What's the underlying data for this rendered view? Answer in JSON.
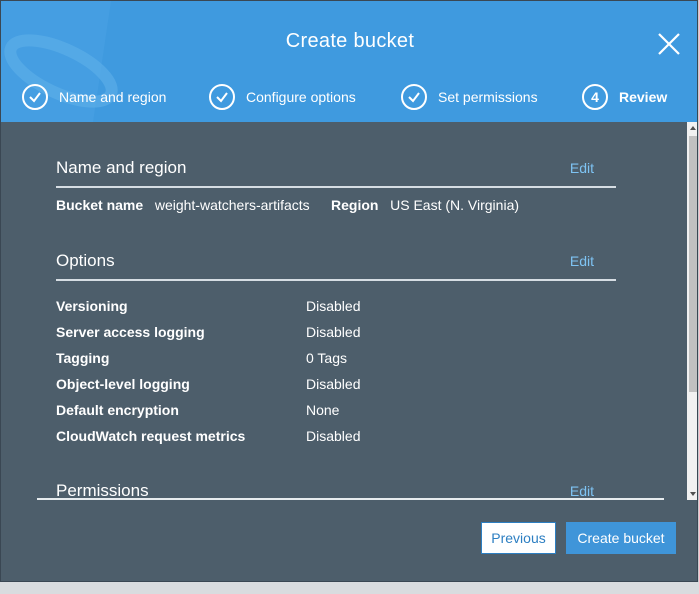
{
  "modal": {
    "title": "Create bucket",
    "steps": [
      {
        "label": "Name and region",
        "state": "done"
      },
      {
        "label": "Configure options",
        "state": "done"
      },
      {
        "label": "Set permissions",
        "state": "done"
      },
      {
        "label": "Review",
        "state": "active",
        "number": "4"
      }
    ]
  },
  "review": {
    "name_region": {
      "title": "Name and region",
      "edit_label": "Edit",
      "bucket_name_label": "Bucket name",
      "bucket_name_value": "weight-watchers-artifacts",
      "region_label": "Region",
      "region_value": "US East (N. Virginia)"
    },
    "options": {
      "title": "Options",
      "edit_label": "Edit",
      "rows": [
        {
          "label": "Versioning",
          "value": "Disabled"
        },
        {
          "label": "Server access logging",
          "value": "Disabled"
        },
        {
          "label": "Tagging",
          "value": "0 Tags"
        },
        {
          "label": "Object-level logging",
          "value": "Disabled"
        },
        {
          "label": "Default encryption",
          "value": "None"
        },
        {
          "label": "CloudWatch request metrics",
          "value": "Disabled"
        }
      ]
    },
    "permissions": {
      "title": "Permissions",
      "edit_label": "Edit"
    }
  },
  "footer": {
    "previous_label": "Previous",
    "create_label": "Create bucket"
  },
  "colors": {
    "header": "#3f9adf",
    "body": "#4d5e6b",
    "link": "#7ec3f3",
    "primary": "#3f95d9"
  }
}
